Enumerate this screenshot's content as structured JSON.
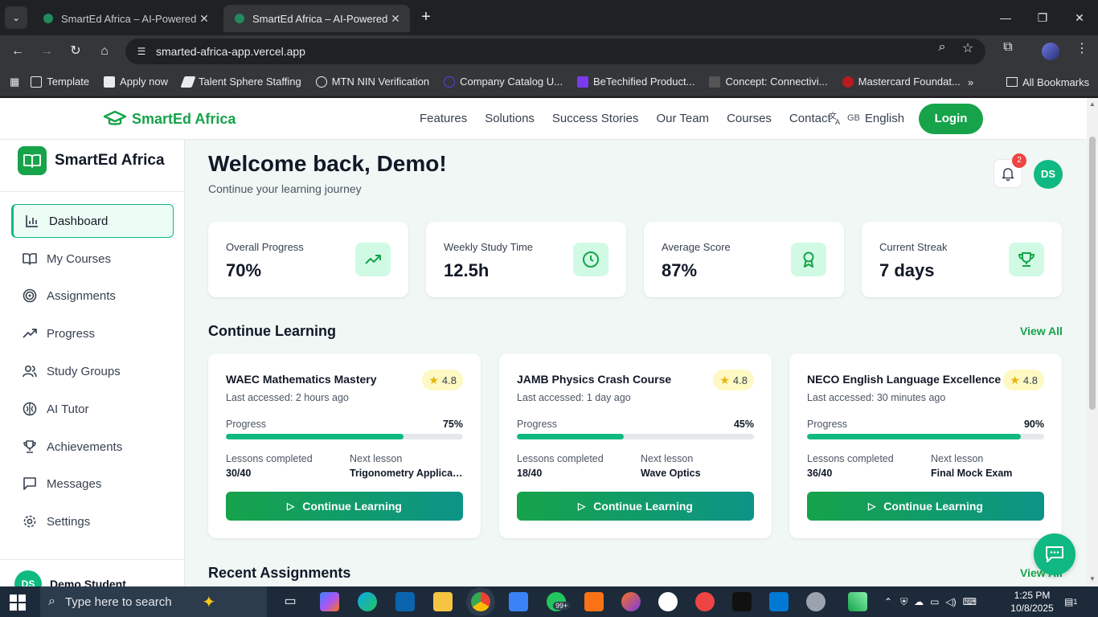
{
  "browser": {
    "tabs": [
      {
        "title": "SmartEd Africa – AI-Powered Of"
      },
      {
        "title": "SmartEd Africa – AI-Powered Of"
      }
    ],
    "url": "smarted-africa-app.vercel.app",
    "bookmarks": [
      {
        "label": "Template"
      },
      {
        "label": "Apply now"
      },
      {
        "label": "Talent Sphere Staffing"
      },
      {
        "label": "MTN NIN Verification"
      },
      {
        "label": "Company Catalog U..."
      },
      {
        "label": "BeTechified Product..."
      },
      {
        "label": "Concept: Connectivi..."
      },
      {
        "label": "Mastercard Foundat..."
      }
    ],
    "all_bookmarks": "All Bookmarks"
  },
  "site_nav": {
    "brand": "SmartEd Africa",
    "links": [
      "Features",
      "Solutions",
      "Success Stories",
      "Our Team",
      "Courses",
      "Contact"
    ],
    "lang_flag": "GB",
    "lang_label": "English",
    "login": "Login"
  },
  "sidebar": {
    "brand": "SmartEd Africa",
    "items": [
      {
        "label": "Dashboard",
        "icon": "bar-chart-icon"
      },
      {
        "label": "My Courses",
        "icon": "book-icon"
      },
      {
        "label": "Assignments",
        "icon": "target-icon"
      },
      {
        "label": "Progress",
        "icon": "trending-up-icon"
      },
      {
        "label": "Study Groups",
        "icon": "users-icon"
      },
      {
        "label": "AI Tutor",
        "icon": "brain-icon"
      },
      {
        "label": "Achievements",
        "icon": "trophy-icon"
      },
      {
        "label": "Messages",
        "icon": "message-icon"
      },
      {
        "label": "Settings",
        "icon": "gear-icon"
      }
    ],
    "user_name": "Demo Student",
    "user_initials": "DS"
  },
  "header": {
    "welcome": "Welcome back, Demo!",
    "subtitle": "Continue your learning journey",
    "notif_count": "2",
    "avatar_initials": "DS"
  },
  "stats": [
    {
      "label": "Overall Progress",
      "value": "70%",
      "icon": "trending-up-icon"
    },
    {
      "label": "Weekly Study Time",
      "value": "12.5h",
      "icon": "clock-icon"
    },
    {
      "label": "Average Score",
      "value": "87%",
      "icon": "award-icon"
    },
    {
      "label": "Current Streak",
      "value": "7 days",
      "icon": "trophy-icon"
    }
  ],
  "continue_learning": {
    "title": "Continue Learning",
    "view_all": "View All",
    "courses": [
      {
        "title": "WAEC Mathematics Mastery",
        "rating": "4.8",
        "last_accessed": "Last accessed: 2 hours ago",
        "progress_label": "Progress",
        "progress": "75%",
        "progress_value": 0.75,
        "lessons_label": "Lessons completed",
        "lessons": "30/40",
        "next_label": "Next lesson",
        "next": "Trigonometry Applications",
        "button": "Continue Learning"
      },
      {
        "title": "JAMB Physics Crash Course",
        "rating": "4.8",
        "last_accessed": "Last accessed: 1 day ago",
        "progress_label": "Progress",
        "progress": "45%",
        "progress_value": 0.45,
        "lessons_label": "Lessons completed",
        "lessons": "18/40",
        "next_label": "Next lesson",
        "next": "Wave Optics",
        "button": "Continue Learning"
      },
      {
        "title": "NECO English Language Excellence",
        "rating": "4.8",
        "last_accessed": "Last accessed: 30 minutes ago",
        "progress_label": "Progress",
        "progress": "90%",
        "progress_value": 0.9,
        "lessons_label": "Lessons completed",
        "lessons": "36/40",
        "next_label": "Next lesson",
        "next": "Final Mock Exam",
        "button": "Continue Learning"
      }
    ]
  },
  "recent_assignments": {
    "title": "Recent Assignments",
    "view_all": "View All"
  },
  "taskbar": {
    "search_placeholder": "Type here to search",
    "time": "1:25 PM",
    "date": "10/8/2025",
    "whatsapp_badge": "99+",
    "notif_count": "1"
  }
}
